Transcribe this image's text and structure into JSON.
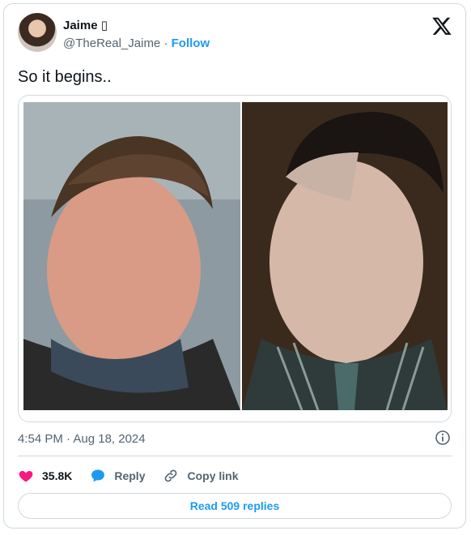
{
  "author": {
    "display_name": "Jaime ▯",
    "handle": "@TheReal_Jaime",
    "separator": " · ",
    "follow_label": "Follow"
  },
  "tweet": {
    "text": "So it begins..",
    "media_description": "photo comparison"
  },
  "meta": {
    "timestamp": "4:54 PM · Aug 18, 2024"
  },
  "actions": {
    "like_count": "35.8K",
    "reply_label": "Reply",
    "copy_link_label": "Copy link"
  },
  "read_replies_label": "Read 509 replies",
  "colors": {
    "accent": "#1d9bf0",
    "like": "#f91880",
    "muted": "#536471",
    "border": "#cfd9de"
  },
  "icons": [
    "x-logo-icon",
    "info-icon",
    "heart-icon",
    "reply-bubble-icon",
    "link-icon"
  ]
}
